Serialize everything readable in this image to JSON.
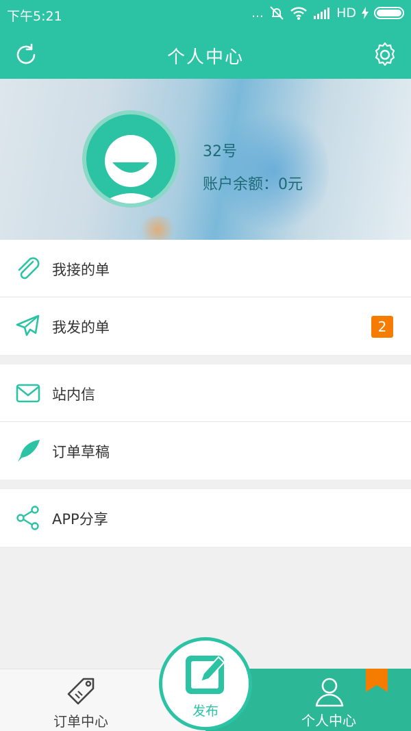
{
  "status_bar": {
    "time": "下午5:21",
    "right_text": "... ",
    "network": "HD"
  },
  "header": {
    "title": "个人中心"
  },
  "profile": {
    "name": "32号",
    "balance": "账户余额：0元"
  },
  "menu": {
    "group1": [
      {
        "label": "我接的单",
        "icon": "paperclip-icon"
      },
      {
        "label": "我发的单",
        "icon": "paper-plane-icon",
        "badge": "2"
      }
    ],
    "group2": [
      {
        "label": "站内信",
        "icon": "envelope-icon"
      },
      {
        "label": "订单草稿",
        "icon": "feather-icon"
      }
    ],
    "group3": [
      {
        "label": "APP分享",
        "icon": "share-icon"
      }
    ]
  },
  "bottom_nav": {
    "orders": "订单中心",
    "publish": "发布",
    "profile": "个人中心"
  },
  "colors": {
    "accent": "#2cc3a4",
    "nav_active": "#2cb897",
    "badge": "#f57c00"
  }
}
